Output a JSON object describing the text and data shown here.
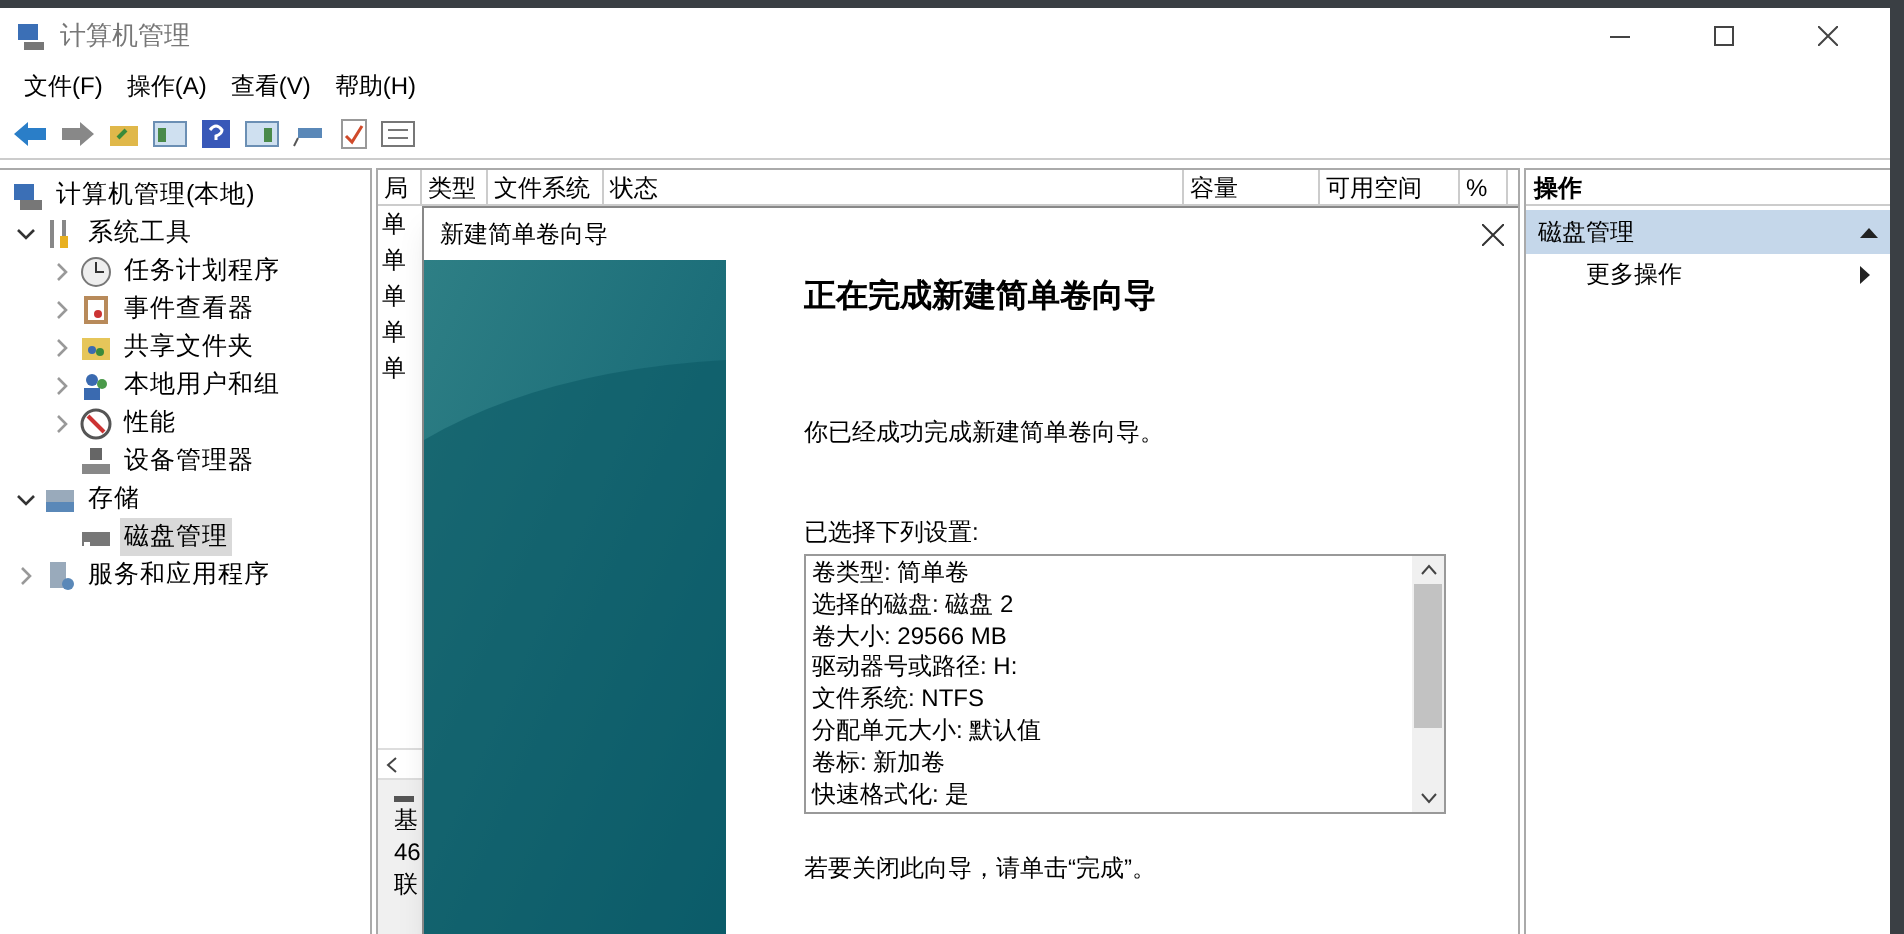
{
  "window": {
    "title": "计算机管理"
  },
  "menu": [
    {
      "label": "文件(F)"
    },
    {
      "label": "操作(A)"
    },
    {
      "label": "查看(V)"
    },
    {
      "label": "帮助(H)"
    }
  ],
  "tree": [
    {
      "label": "计算机管理(本地)",
      "selected": false,
      "children": [
        {
          "label": "系统工具",
          "selected": false,
          "expanded": true,
          "children": [
            {
              "label": "任务计划程序",
              "selected": false,
              "expanded": false
            },
            {
              "label": "事件查看器",
              "selected": false,
              "expanded": false
            },
            {
              "label": "共享文件夹",
              "selected": false,
              "expanded": false
            },
            {
              "label": "本地用户和组",
              "selected": false,
              "expanded": false
            },
            {
              "label": "性能",
              "selected": false,
              "expanded": false
            },
            {
              "label": "设备管理器",
              "selected": false
            }
          ]
        },
        {
          "label": "存储",
          "selected": false,
          "expanded": true,
          "children": [
            {
              "label": "磁盘管理",
              "selected": true
            }
          ]
        },
        {
          "label": "服务和应用程序",
          "selected": false,
          "expanded": false
        }
      ]
    }
  ],
  "table": {
    "columns": [
      "局",
      "类型",
      "文件系统",
      "状态",
      "容量",
      "可用空间",
      "%"
    ],
    "rows": [
      "单",
      "单",
      "单",
      "单",
      "单"
    ]
  },
  "disk_panel": {
    "lines": [
      "基",
      "46",
      "联"
    ]
  },
  "actions": {
    "header": "操作",
    "section": "磁盘管理",
    "items": [
      {
        "label": "更多操作"
      }
    ]
  },
  "dialog": {
    "title": "新建简单卷向导",
    "heading": "正在完成新建简单卷向导",
    "intro": "你已经成功完成新建简单卷向导。",
    "settings_label": "已选择下列设置:",
    "settings": [
      "卷类型: 简单卷",
      "选择的磁盘: 磁盘 2",
      "卷大小: 29566 MB",
      "驱动器号或路径: H:",
      "文件系统: NTFS",
      "分配单元大小: 默认值",
      "卷标: 新加卷",
      "快速格式化: 是"
    ],
    "footer": "若要关闭此向导，请单击“完成”。"
  }
}
